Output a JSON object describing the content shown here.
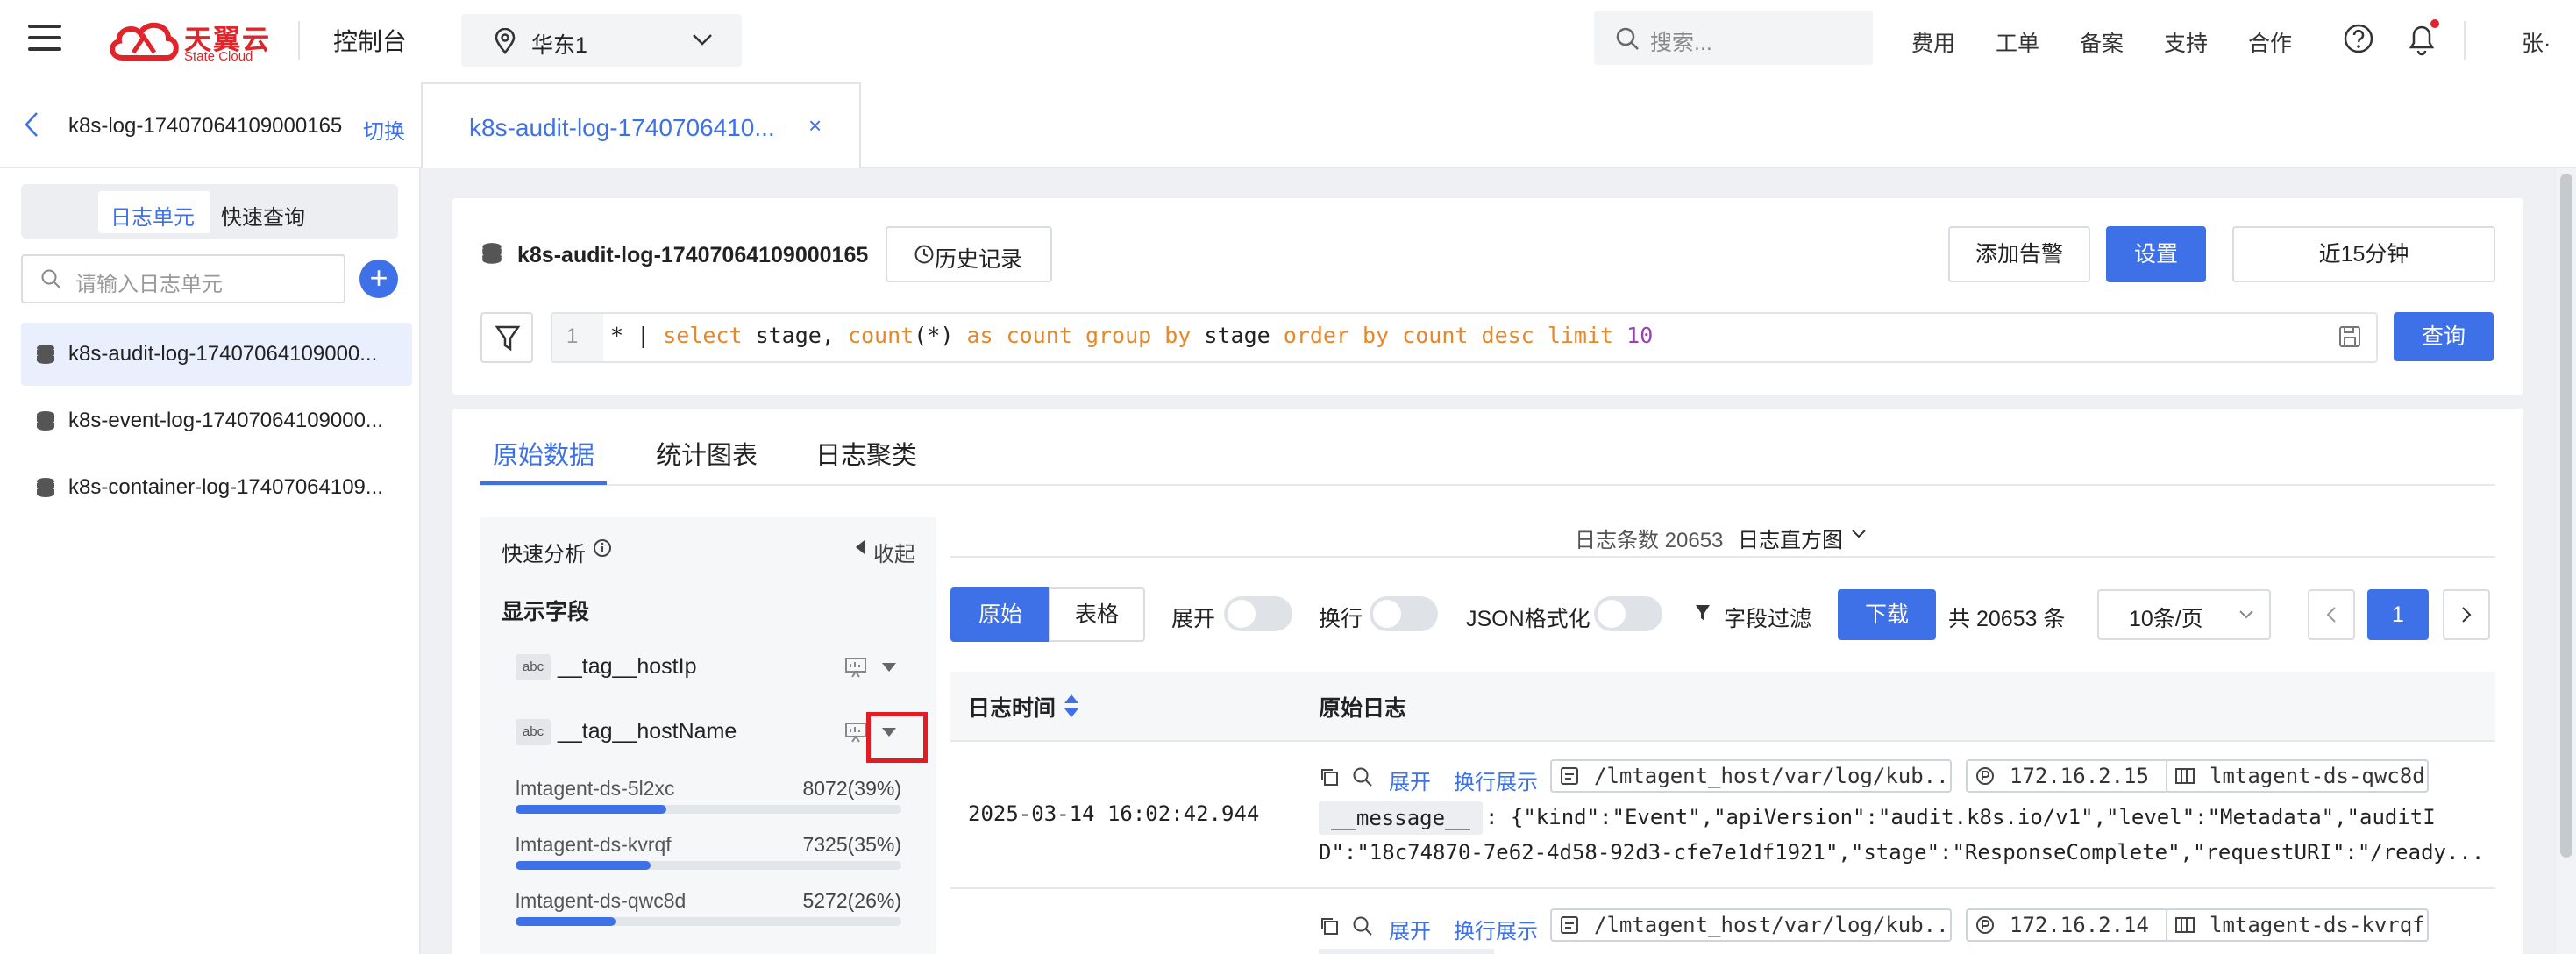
{
  "topbar": {
    "brand_cn": "天翼云",
    "brand_en": "State Cloud",
    "console": "控制台",
    "region": "华东1",
    "search_placeholder": "搜索...",
    "nav": [
      "费用",
      "工单",
      "备案",
      "支持",
      "合作"
    ],
    "user": "张·"
  },
  "tabs": {
    "back_name": "k8s-log-17407064109000165",
    "switch": "切换",
    "active": "k8s-audit-log-1740706410...",
    "close": "×"
  },
  "sidebar": {
    "seg": [
      "日志单元",
      "快速查询"
    ],
    "search_placeholder": "请输入日志单元",
    "add": "+",
    "items": [
      "k8s-audit-log-17407064109000...",
      "k8s-event-log-17407064109000...",
      "k8s-container-log-17407064109..."
    ]
  },
  "query": {
    "logname": "k8s-audit-log-17407064109000165",
    "history": "历史记录",
    "add_alert": "添加告警",
    "settings": "设置",
    "time_range": "近15分钟",
    "line_no": "1",
    "run": "查询",
    "tokens": [
      {
        "t": "* | ",
        "c": "pl"
      },
      {
        "t": "select",
        "c": "kw"
      },
      {
        "t": " stage, ",
        "c": "pl"
      },
      {
        "t": "count",
        "c": "kw"
      },
      {
        "t": "(*) ",
        "c": "pl"
      },
      {
        "t": "as",
        "c": "kw"
      },
      {
        "t": " ",
        "c": "pl"
      },
      {
        "t": "count",
        "c": "kw"
      },
      {
        "t": " ",
        "c": "pl"
      },
      {
        "t": "group by",
        "c": "kw"
      },
      {
        "t": " stage ",
        "c": "pl"
      },
      {
        "t": "order by",
        "c": "kw"
      },
      {
        "t": " ",
        "c": "pl"
      },
      {
        "t": "count",
        "c": "kw"
      },
      {
        "t": " ",
        "c": "pl"
      },
      {
        "t": "desc",
        "c": "kw"
      },
      {
        "t": " ",
        "c": "pl"
      },
      {
        "t": "limit",
        "c": "kw"
      },
      {
        "t": " ",
        "c": "pl"
      },
      {
        "t": "10",
        "c": "num"
      }
    ]
  },
  "main_tabs": [
    "原始数据",
    "统计图表",
    "日志聚类"
  ],
  "quick": {
    "title": "快速分析",
    "collapse": "收起",
    "fields_title": "显示字段",
    "abc": "abc",
    "fields": [
      "__tag__hostIp",
      "__tag__hostName"
    ],
    "values": [
      {
        "name": "lmtagent-ds-5l2xc",
        "count": "8072(39%)",
        "pct": 39
      },
      {
        "name": "lmtagent-ds-kvrqf",
        "count": "7325(35%)",
        "pct": 35
      },
      {
        "name": "lmtagent-ds-qwc8d",
        "count": "5272(26%)",
        "pct": 26
      }
    ]
  },
  "results": {
    "count_label": "日志条数 20653",
    "histogram": "日志直方图",
    "raw": "原始",
    "table": "表格",
    "expand": "展开",
    "wrap": "换行",
    "json": "JSON格式化",
    "field_filter": "字段过滤",
    "download": "下载",
    "total": "共 20653 条",
    "page_size": "10条/页",
    "page": "1",
    "col_time": "日志时间",
    "col_raw": "原始日志",
    "rows": [
      {
        "time": "2025-03-14 16:02:42.944",
        "expand": "展开",
        "wrap_show": "换行展示",
        "path": "/lmtagent_host/var/log/kub...",
        "ip": "172.16.2.15",
        "host": "lmtagent-ds-qwc8d",
        "msg_key": "__message__",
        "msg1": ": {\"kind\":\"Event\",\"apiVersion\":\"audit.k8s.io/v1\",\"level\":\"Metadata\",\"auditI",
        "msg2": "D\":\"18c74870-7e62-4d58-92d3-cfe7e1df1921\",\"stage\":\"ResponseComplete\",\"requestURI\":\"/ready..."
      },
      {
        "expand": "展开",
        "wrap_show": "换行展示",
        "path": "/lmtagent_host/var/log/kub...",
        "ip": "172.16.2.14",
        "host": "lmtagent-ds-kvrqf"
      }
    ]
  }
}
